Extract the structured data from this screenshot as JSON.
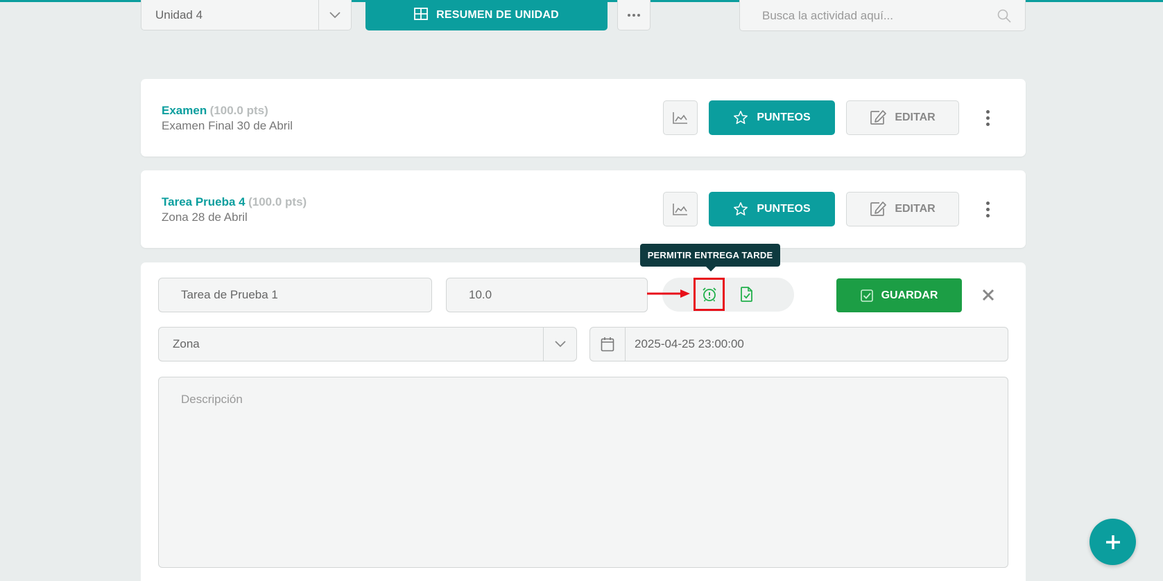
{
  "toolbar": {
    "unit_selected": "Unidad 4",
    "summary_label": "RESUMEN DE UNIDAD",
    "search_placeholder": "Busca la actividad aquí..."
  },
  "activities": [
    {
      "title": "Examen",
      "points": "(100.0 pts)",
      "subtitle": "Examen Final 30 de Abril",
      "scores_label": "PUNTEOS",
      "edit_label": "EDITAR"
    },
    {
      "title": "Tarea Prueba 4",
      "points": "(100.0 pts)",
      "subtitle": "Zona 28 de Abril",
      "scores_label": "PUNTEOS",
      "edit_label": "EDITAR"
    }
  ],
  "form": {
    "name_value": "Tarea de Prueba 1",
    "points_value": "10.0",
    "tooltip": "PERMITIR ENTREGA TARDE",
    "save_label": "GUARDAR",
    "type_selected": "Zona",
    "date_value": "2025-04-25 23:00:00",
    "description_placeholder": "Descripción"
  },
  "icons": {
    "chevron": "chevron-down-icon",
    "grid": "grid-icon",
    "search": "search-icon",
    "chart": "chart-icon",
    "star": "star-icon",
    "edit": "edit-icon",
    "late": "alarm-clock-icon",
    "doc": "check-document-icon",
    "calendar": "calendar-icon",
    "plus": "plus-icon"
  },
  "colors": {
    "brand": "#0b9e9e",
    "save": "#1c9e45",
    "highlight": "#e8101a",
    "tooltip_bg": "#0e3a3f",
    "icon_green": "#22b04b"
  }
}
